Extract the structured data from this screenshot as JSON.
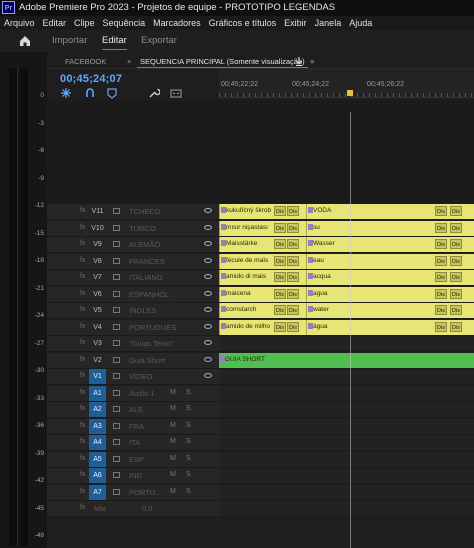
{
  "window": {
    "logo": "Pr",
    "title": "Adobe Premiere Pro 2023 - Projetos de equipe - PROTOTIPO LEGENDAS"
  },
  "menu": [
    "Arquivo",
    "Editar",
    "Clipe",
    "Sequência",
    "Marcadores",
    "Gráficos e títulos",
    "Exibir",
    "Janela",
    "Ajuda"
  ],
  "workspace": {
    "tabs": [
      "Importar",
      "Editar",
      "Exportar"
    ],
    "active": "Editar"
  },
  "meter": {
    "labels": [
      "0",
      "-3",
      "-6",
      "-9",
      "-12",
      "-15",
      "-18",
      "-21",
      "-24",
      "-27",
      "-30",
      "-33",
      "-36",
      "-39",
      "-42",
      "-45",
      "-48"
    ]
  },
  "panel": {
    "tab1": "FACEBOOK",
    "close": "×",
    "tab2": "SEQUENCIA PRINCIPAL (Somente visualização)",
    "menu_icon": "≡",
    "timecode": "00;45;24;07",
    "ruler": [
      "00;45;22;22",
      "00;45;24;22",
      "00;45;26;22"
    ]
  },
  "video_tracks": [
    {
      "id": "V11",
      "label": "TCHECO",
      "clips": [
        "kukuřičný škrob",
        "VODA"
      ]
    },
    {
      "id": "V10",
      "label": "TURCO",
      "clips": [
        "mısır nişastası",
        "su"
      ]
    },
    {
      "id": "V9",
      "label": "ALEMÃO",
      "clips": [
        "Maisstärke",
        "Wasser"
      ]
    },
    {
      "id": "V8",
      "label": "FRANCES",
      "clips": [
        "fécule de maïs",
        "eau"
      ]
    },
    {
      "id": "V7",
      "label": "ITALIANO",
      "clips": [
        "amido di mais",
        "acqua"
      ]
    },
    {
      "id": "V6",
      "label": "ESPANHOL",
      "clips": [
        "maicena",
        "agua"
      ]
    },
    {
      "id": "V5",
      "label": "INGLES",
      "clips": [
        "cornstarch",
        "water"
      ]
    },
    {
      "id": "V4",
      "label": "PORTUGUES",
      "clips": [
        "amido de milho",
        "água"
      ]
    },
    {
      "id": "V3",
      "label": "\"Guias Texto\"",
      "clips": []
    },
    {
      "id": "V2",
      "label": "Guia Short",
      "clips": [
        "GUIA SHORT"
      ]
    },
    {
      "id": "V1",
      "label": "VIDEO",
      "clips": []
    }
  ],
  "audio_tracks": [
    {
      "id": "A1",
      "label": "Áudio 1"
    },
    {
      "id": "A2",
      "label": "ALE"
    },
    {
      "id": "A3",
      "label": "FRA"
    },
    {
      "id": "A4",
      "label": "ITA"
    },
    {
      "id": "A5",
      "label": "ESP"
    },
    {
      "id": "A6",
      "label": "ING"
    },
    {
      "id": "A7",
      "label": "PORTU..."
    }
  ],
  "mix": {
    "label": "Mix",
    "value": "0.0"
  },
  "dissolve_labels": [
    "Dis",
    "Dis"
  ],
  "colors": {
    "caption_clip": "#e6e575",
    "guide_clip": "#4fbf51",
    "timecode": "#5fa8ff",
    "target": "#1f5f96"
  }
}
